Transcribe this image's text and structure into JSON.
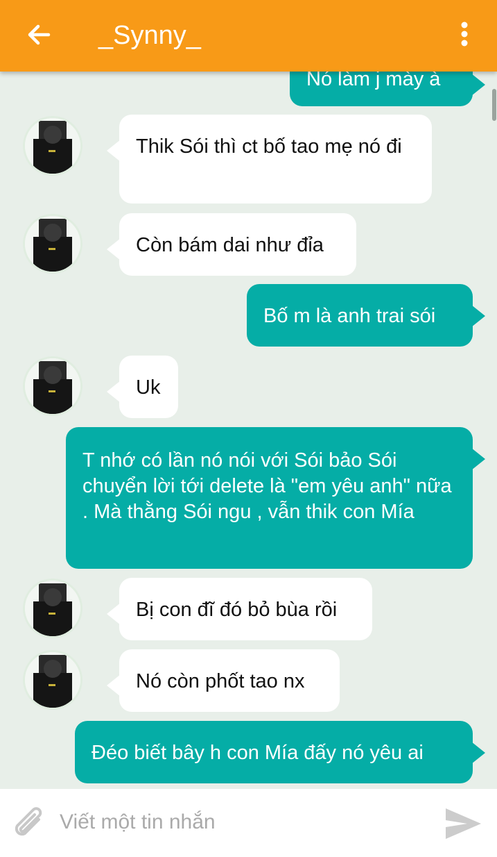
{
  "header": {
    "title": "_Synny_",
    "back_icon": "arrow-left-icon",
    "menu_icon": "more-vertical-icon",
    "bar_color": "#f89a17"
  },
  "messages": [
    {
      "direction": "out",
      "text": "Nó làm j mày à"
    },
    {
      "direction": "in",
      "text": "Thik Sói thì ct bố tao mẹ nó đi"
    },
    {
      "direction": "in",
      "text": "Còn bám dai như đỉa"
    },
    {
      "direction": "out",
      "text": "Bố m là anh trai sói"
    },
    {
      "direction": "in",
      "text": "Uk"
    },
    {
      "direction": "out",
      "text": "T nhớ có lần nó nói với Sói bảo Sói chuyển lời tới delete là \"em yêu anh\" nữa . Mà thằng Sói ngu , vẫn thik con Mía"
    },
    {
      "direction": "in",
      "text": "Bị con đĩ đó bỏ bùa rồi"
    },
    {
      "direction": "in",
      "text": "Nó còn phốt tao nx"
    },
    {
      "direction": "out",
      "text": "Đéo biết bây h con Mía đấy nó yêu ai"
    }
  ],
  "composer": {
    "placeholder": "Viết một tin nhắn",
    "value": "",
    "attach_icon": "paperclip-icon",
    "send_icon": "send-icon"
  },
  "colors": {
    "background": "#e8efe9",
    "incoming_bubble": "#ffffff",
    "outgoing_bubble": "#05ada6"
  }
}
